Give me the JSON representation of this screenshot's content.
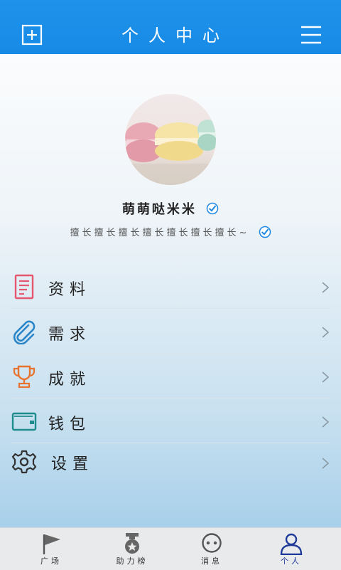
{
  "header": {
    "title": "个人中心"
  },
  "profile": {
    "name": "萌萌哒米米",
    "bio": "擅长擅长擅长擅长擅长擅长擅长~"
  },
  "menu": [
    {
      "label": "资料",
      "icon": "document-icon",
      "color": "#e6566f"
    },
    {
      "label": "需求",
      "icon": "paperclip-icon",
      "color": "#2a86c9"
    },
    {
      "label": "成就",
      "icon": "trophy-icon",
      "color": "#e8732e"
    },
    {
      "label": "钱包",
      "icon": "wallet-icon",
      "color": "#1e8c8c"
    },
    {
      "label": "设置",
      "icon": "gear-icon",
      "color": "#333333"
    }
  ],
  "tabs": [
    {
      "label": "广场",
      "icon": "flag-icon"
    },
    {
      "label": "助力榜",
      "icon": "medal-icon"
    },
    {
      "label": "消息",
      "icon": "chat-icon"
    },
    {
      "label": "个人",
      "icon": "person-icon",
      "active": true
    }
  ],
  "colors": {
    "header": "#1a8ee8",
    "active_tab": "#1e3a9a"
  }
}
